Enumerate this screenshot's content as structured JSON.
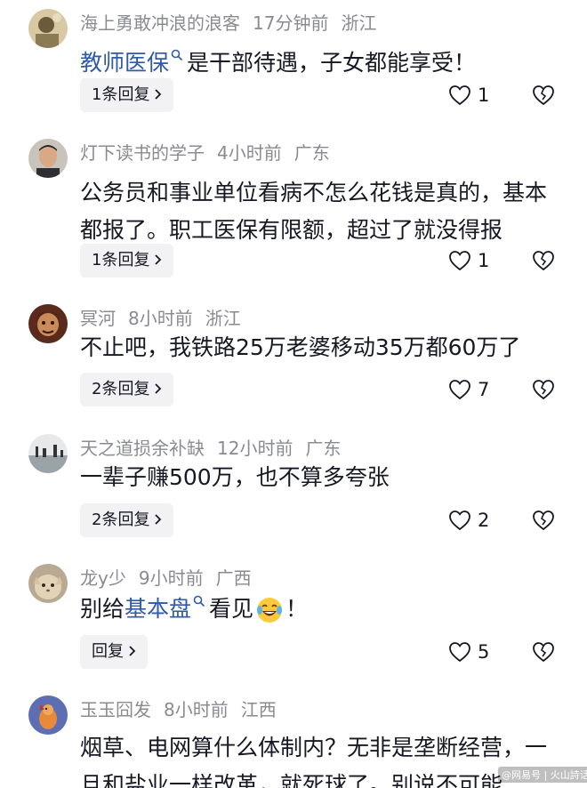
{
  "comments": [
    {
      "username": "海上勇敢冲浪的浪客",
      "time": "17分钟前",
      "location": "浙江",
      "text_parts": {
        "link": "教师医保",
        "rest": "是干部待遇，子女都能享受！"
      },
      "reply_label": "1条回复",
      "like_count": "1"
    },
    {
      "username": "灯下读书的学子",
      "time": "4小时前",
      "location": "广东",
      "text": "公务员和事业单位看病不怎么花钱是真的，基本都报了。职工医保有限额，超过了就没得报",
      "reply_label": "1条回复",
      "like_count": "1"
    },
    {
      "username": "冥河",
      "time": "8小时前",
      "location": "浙江",
      "text": "不止吧，我铁路25万老婆移动35万都60万了",
      "reply_label": "2条回复",
      "like_count": "7"
    },
    {
      "username": "天之道损余补缺",
      "time": "12小时前",
      "location": "广东",
      "text": "一辈子赚500万，也不算多夸张",
      "reply_label": "2条回复",
      "like_count": "2"
    },
    {
      "username": "龙y少",
      "time": "9小时前",
      "location": "广西",
      "text_parts": {
        "before": "别给",
        "link": "基本盘",
        "after_emoji_prefix": "看见",
        "end": "！"
      },
      "emoji": "laughing-tears-emoji",
      "reply_label": "回复",
      "like_count": "5"
    },
    {
      "username": "玉玉囧发",
      "time": "8小时前",
      "location": "江西",
      "text": "烟草、电网算什么体制内？无非是垄断经营，一旦和盐业一样改革，就死球了。别说不可能"
    }
  ],
  "icons": {
    "like": "heart-outline-icon",
    "dislike": "broken-heart-icon",
    "search": "search-icon",
    "chevron": "chevron-right-icon"
  },
  "colors": {
    "link": "#2f5aa8",
    "meta": "#8a8b91",
    "reply_bg": "#f2f2f4"
  },
  "watermark": "@网易号 | 火山詩话"
}
